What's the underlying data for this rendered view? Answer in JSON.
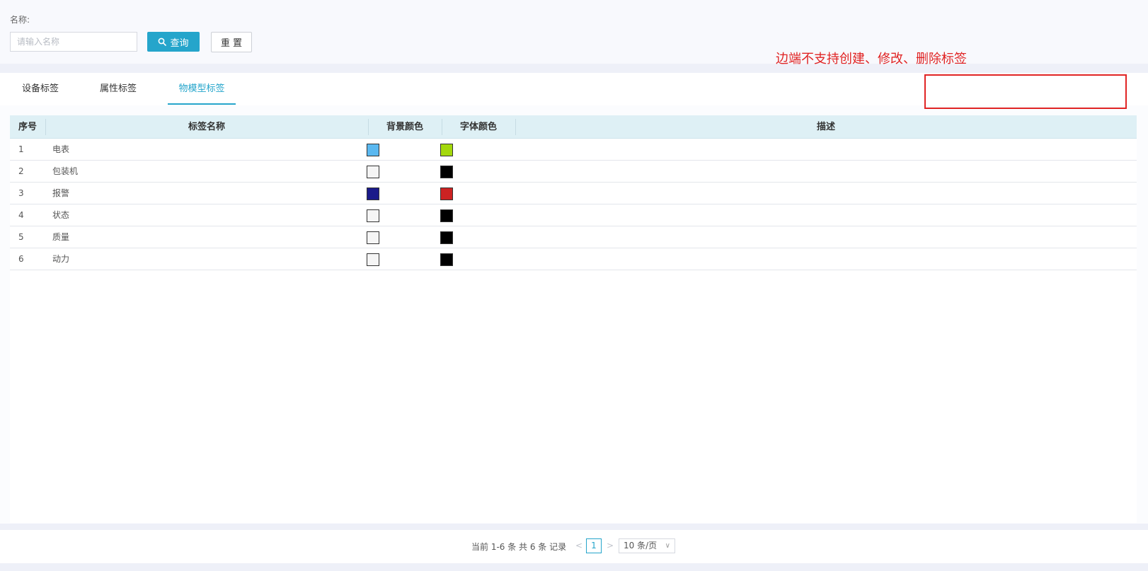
{
  "search": {
    "label": "名称:",
    "placeholder": "请输入名称",
    "value": "",
    "query_label": "查询",
    "reset_label": "重 置"
  },
  "tabs": [
    {
      "label": "设备标签",
      "active": false
    },
    {
      "label": "属性标签",
      "active": false
    },
    {
      "label": "物模型标签",
      "active": true
    }
  ],
  "annotation": {
    "text": "边端不支持创建、修改、删除标签",
    "color": "#e02424"
  },
  "table": {
    "columns": [
      "序号",
      "标签名称",
      "背景颜色",
      "字体颜色",
      "描述"
    ],
    "rows": [
      {
        "index": "1",
        "name": "电表",
        "bg_color": "#5ab8f0",
        "font_color": "#a3d80c",
        "description": ""
      },
      {
        "index": "2",
        "name": "包装机",
        "bg_color": "#f5f5f5",
        "font_color": "#000000",
        "description": ""
      },
      {
        "index": "3",
        "name": "报警",
        "bg_color": "#1a1a8a",
        "font_color": "#cc2222",
        "description": ""
      },
      {
        "index": "4",
        "name": "状态",
        "bg_color": "#f5f5f5",
        "font_color": "#000000",
        "description": ""
      },
      {
        "index": "5",
        "name": "质量",
        "bg_color": "#f5f5f5",
        "font_color": "#000000",
        "description": ""
      },
      {
        "index": "6",
        "name": "动力",
        "bg_color": "#f5f5f5",
        "font_color": "#000000",
        "description": ""
      }
    ]
  },
  "pagination": {
    "total_text": "当前 1-6 条 共 6 条 记录",
    "prev": "<",
    "current_page": "1",
    "next": ">",
    "page_size": "10 条/页"
  },
  "colors": {
    "accent": "#25a5cb",
    "header_bg": "#def0f5"
  },
  "icons": {
    "query": "search-icon",
    "page_size": "chevron-down-icon"
  }
}
